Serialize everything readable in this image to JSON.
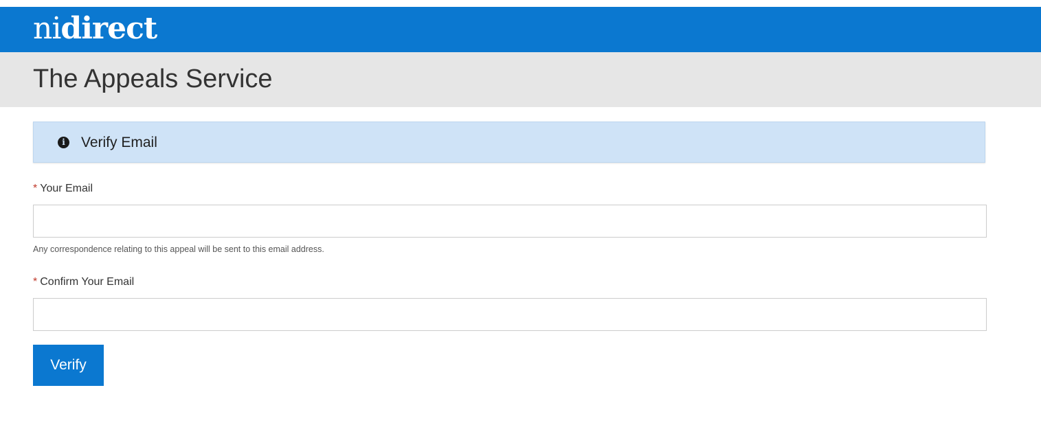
{
  "brand": {
    "logo_ni": "ni",
    "logo_direct": "direct"
  },
  "service": {
    "title": "The Appeals Service"
  },
  "alert": {
    "icon": "info-circle-icon",
    "text": "Verify Email"
  },
  "form": {
    "email": {
      "required_marker": "*",
      "label": "Your Email",
      "value": "",
      "hint": "Any correspondence relating to this appeal will be sent to this email address."
    },
    "confirm_email": {
      "required_marker": "*",
      "label": "Confirm Your Email",
      "value": ""
    },
    "submit_label": "Verify"
  },
  "colors": {
    "brand_blue": "#0b78d0",
    "service_bar": "#e6e6e6",
    "alert_bg": "#cfe3f7",
    "required": "#c0392b"
  }
}
